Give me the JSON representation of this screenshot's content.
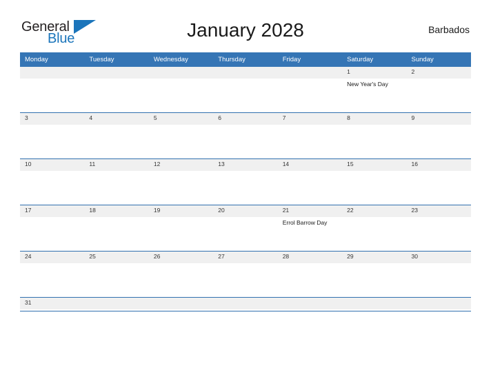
{
  "brand": {
    "name_part1": "General",
    "name_part2": "Blue",
    "flag_icon": "blue-flag-icon",
    "color_dark": "#231f20",
    "color_blue": "#1b75bb"
  },
  "header": {
    "title": "January 2028",
    "country": "Barbados"
  },
  "calendar": {
    "accent_color": "#3575b5",
    "band_color": "#f0f0f0",
    "weekday_headers": [
      "Monday",
      "Tuesday",
      "Wednesday",
      "Thursday",
      "Friday",
      "Saturday",
      "Sunday"
    ],
    "weeks": [
      {
        "days": [
          {
            "num": "",
            "event": ""
          },
          {
            "num": "",
            "event": ""
          },
          {
            "num": "",
            "event": ""
          },
          {
            "num": "",
            "event": ""
          },
          {
            "num": "",
            "event": ""
          },
          {
            "num": "1",
            "event": "New Year's Day"
          },
          {
            "num": "2",
            "event": ""
          }
        ]
      },
      {
        "days": [
          {
            "num": "3",
            "event": ""
          },
          {
            "num": "4",
            "event": ""
          },
          {
            "num": "5",
            "event": ""
          },
          {
            "num": "6",
            "event": ""
          },
          {
            "num": "7",
            "event": ""
          },
          {
            "num": "8",
            "event": ""
          },
          {
            "num": "9",
            "event": ""
          }
        ]
      },
      {
        "days": [
          {
            "num": "10",
            "event": ""
          },
          {
            "num": "11",
            "event": ""
          },
          {
            "num": "12",
            "event": ""
          },
          {
            "num": "13",
            "event": ""
          },
          {
            "num": "14",
            "event": ""
          },
          {
            "num": "15",
            "event": ""
          },
          {
            "num": "16",
            "event": ""
          }
        ]
      },
      {
        "days": [
          {
            "num": "17",
            "event": ""
          },
          {
            "num": "18",
            "event": ""
          },
          {
            "num": "19",
            "event": ""
          },
          {
            "num": "20",
            "event": ""
          },
          {
            "num": "21",
            "event": "Errol Barrow Day"
          },
          {
            "num": "22",
            "event": ""
          },
          {
            "num": "23",
            "event": ""
          }
        ]
      },
      {
        "days": [
          {
            "num": "24",
            "event": ""
          },
          {
            "num": "25",
            "event": ""
          },
          {
            "num": "26",
            "event": ""
          },
          {
            "num": "27",
            "event": ""
          },
          {
            "num": "28",
            "event": ""
          },
          {
            "num": "29",
            "event": ""
          },
          {
            "num": "30",
            "event": ""
          }
        ]
      },
      {
        "days": [
          {
            "num": "31",
            "event": ""
          },
          {
            "num": "",
            "event": ""
          },
          {
            "num": "",
            "event": ""
          },
          {
            "num": "",
            "event": ""
          },
          {
            "num": "",
            "event": ""
          },
          {
            "num": "",
            "event": ""
          },
          {
            "num": "",
            "event": ""
          }
        ]
      }
    ]
  }
}
